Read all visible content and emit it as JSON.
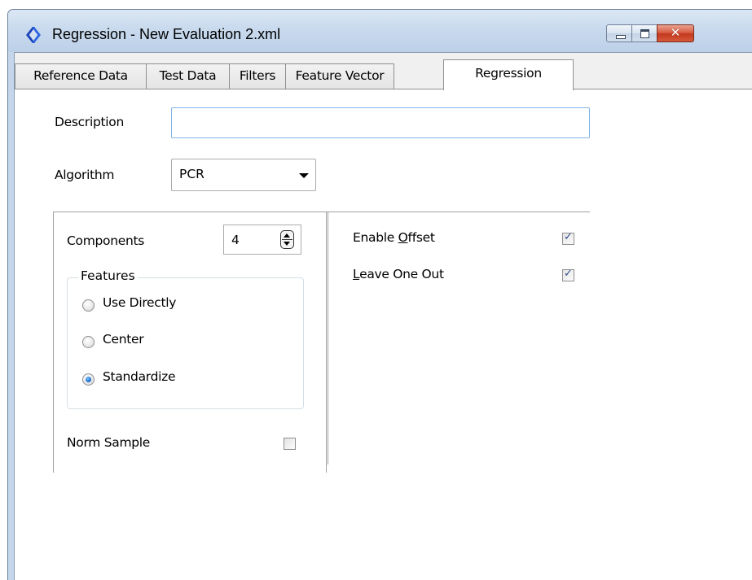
{
  "window": {
    "title": "Regression - New Evaluation 2.xml",
    "icons": {
      "app": "app-logo-icon",
      "minimize": "minimize-icon",
      "maximize": "maximize-icon",
      "close": "close-icon"
    },
    "colors": {
      "titlebar": "#c9daee",
      "close_button": "#c3371d",
      "focus_border": "#7eb4ea"
    }
  },
  "tabs": [
    {
      "label": "Reference Data",
      "active": false
    },
    {
      "label": "Test Data",
      "active": false
    },
    {
      "label": "Filters",
      "active": false
    },
    {
      "label": "Feature Vector",
      "active": false
    },
    {
      "label": "Regression",
      "active": true
    }
  ],
  "form": {
    "description": {
      "label": "Description",
      "value": "",
      "placeholder": ""
    },
    "algorithm": {
      "label": "Algorithm",
      "value": "PCR"
    },
    "components": {
      "label": "Components",
      "value": "4"
    },
    "features": {
      "legend": "Features",
      "options": [
        {
          "label": "Use Directly",
          "checked": false
        },
        {
          "label": "Center",
          "checked": false
        },
        {
          "label": "Standardize",
          "checked": true
        }
      ]
    },
    "norm_sample": {
      "label": "Norm Sample",
      "checked": false
    },
    "enable_offset": {
      "label_pre": "Enable ",
      "label_key": "O",
      "label_post": "ffset",
      "checked": true
    },
    "leave_one_out": {
      "label_pre": "",
      "label_key": "L",
      "label_post": "eave One Out",
      "checked": true
    }
  }
}
